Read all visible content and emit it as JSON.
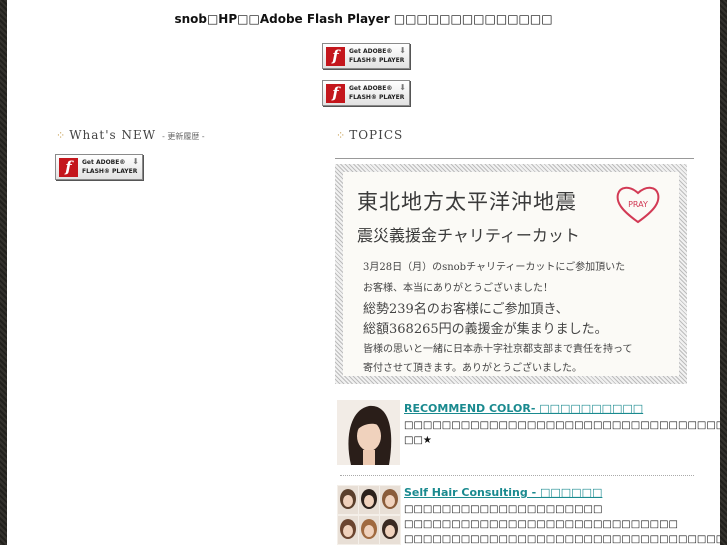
{
  "notice": "snob□HP□□Adobe Flash Player □□□□□□□□□□□□□□",
  "flash_badge": {
    "line1": "Get ADOBE®",
    "line2": "FLASH® PLAYER",
    "logo": "f",
    "arrow": "⬇"
  },
  "whats_new": {
    "title": "What's NEW",
    "subtitle": "- 更新履歴 -"
  },
  "topics": {
    "title": "TOPICS"
  },
  "banner": {
    "title": "東北地方太平洋沖地震",
    "subtitle": "震災義援金チャリティーカット",
    "pray": "PRAY",
    "line1": "3月28日（月）のsnobチャリティーカットにご参加頂いた",
    "line2": "お客様、本当にありがとうございました！",
    "line3": "総勢239名のお客様にご参加頂き、",
    "line4": "総額368265円の義援金が集まりました。",
    "line5": "皆様の思いと一緒に日本赤十字社京都支部まで責任を持って",
    "line6": "寄付させて頂きます。ありがとうございました。"
  },
  "items": [
    {
      "title": "RECOMMEND COLOR- □□□□□□□□□□",
      "text1": "□□□□□□□□□□□□□□□□□□□□□□□□□□□□□□□□□□□□□□□□□□□□□□□",
      "text2": "□□★"
    },
    {
      "title": "Self Hair Consulting - □□□□□□",
      "text1": "□□□□□□□□□□□□□□□□□□□□□",
      "text2": "□□□□□□□□□□□□□□□□□□□□□□□□□□□□□",
      "text3": "□□□□□□□□□□□□□□□□□□□□□□□□□□□□□□□□□□□□□□□□□□□□□□□"
    }
  ]
}
